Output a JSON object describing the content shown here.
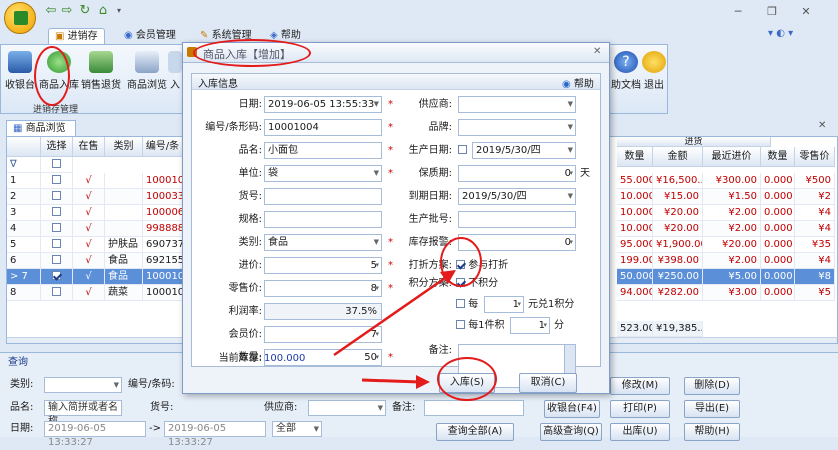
{
  "ribbon": {
    "tabs": [
      "进销存",
      "会员管理",
      "系统管理",
      "帮助"
    ],
    "buttons": [
      "收银台",
      "商品入库",
      "销售退货",
      "商品浏览",
      "入"
    ],
    "right_buttons": [
      "助文档",
      "退出"
    ],
    "group_label": "进销存管理"
  },
  "main_tab": "商品浏览",
  "grid": {
    "headers": [
      "选择",
      "在售",
      "类别",
      "编号/条"
    ],
    "right_group": "进货",
    "right_headers": [
      "数量",
      "金额",
      "最近进价",
      "数量",
      "零售价"
    ],
    "filter_row": "∇",
    "rows": [
      {
        "num": "1",
        "sel": false,
        "onsale": "√",
        "cat": "",
        "code": "100010",
        "qty": "55.000",
        "amount": "¥16,500....",
        "last": "¥300.00",
        "q2": "0.000",
        "price": "¥500"
      },
      {
        "num": "2",
        "sel": false,
        "onsale": "√",
        "cat": "",
        "code": "100033",
        "qty": "10.000",
        "amount": "¥15.00",
        "last": "¥1.50",
        "q2": "0.000",
        "price": "¥2"
      },
      {
        "num": "3",
        "sel": false,
        "onsale": "√",
        "cat": "",
        "code": "100006",
        "qty": "10.000",
        "amount": "¥20.00",
        "last": "¥2.00",
        "q2": "0.000",
        "price": "¥4"
      },
      {
        "num": "4",
        "sel": false,
        "onsale": "√",
        "cat": "",
        "code": "998888",
        "qty": "10.000",
        "amount": "¥20.00",
        "last": "¥2.00",
        "q2": "0.000",
        "price": "¥4"
      },
      {
        "num": "5",
        "sel": false,
        "onsale": "√",
        "cat": "护肤品",
        "code": "690737",
        "qty": "95.000",
        "amount": "¥1,900.00",
        "last": "¥20.00",
        "q2": "0.000",
        "price": "¥35"
      },
      {
        "num": "6",
        "sel": false,
        "onsale": "√",
        "cat": "食品",
        "code": "692155",
        "qty": "199.000",
        "amount": "¥398.00",
        "last": "¥2.00",
        "q2": "0.000",
        "price": "¥4"
      },
      {
        "num": "> 7",
        "sel": true,
        "onsale": "√",
        "cat": "食品",
        "code": "100010",
        "qty": "50.000",
        "amount": "¥250.00",
        "last": "¥5.00",
        "q2": "0.000",
        "price": "¥8"
      },
      {
        "num": "8",
        "sel": false,
        "onsale": "√",
        "cat": "蔬菜",
        "code": "100010",
        "qty": "94.000",
        "amount": "¥282.00",
        "last": "¥3.00",
        "q2": "0.000",
        "price": "¥5"
      }
    ],
    "totals": {
      "qty": "523.000",
      "amount": "¥19,385..."
    }
  },
  "query": {
    "title": "查询",
    "labels": {
      "category": "类别:",
      "code": "编号/条码:",
      "name": "品名:",
      "goods_no": "货号:",
      "supplier": "供应商:",
      "note": "备注:",
      "date": "日期:"
    },
    "name_value": "输入简拼或者名称",
    "date_from": "2019-06-05 13:33:27",
    "date_to": "2019-06-05 13:33:27",
    "date_sep": "->",
    "range": "全部",
    "buttons": [
      "修改(M)",
      "删除(D)",
      "收银台(F4)",
      "打印(P)",
      "导出(E)",
      "查询全部(A)",
      "高级查询(Q)",
      "出库(U)",
      "帮助(H)"
    ]
  },
  "dialog": {
    "title": "商品入库【增加】",
    "section": "入库信息",
    "help": "帮助",
    "fields": {
      "date_label": "日期:",
      "date": "2019-06-05 13:55:33",
      "code_label": "编号/条形码:",
      "code": "10001004",
      "name_label": "品名:",
      "name": "小面包",
      "unit_label": "单位:",
      "unit": "袋",
      "goods_no_label": "货号:",
      "spec_label": "规格:",
      "category_label": "类别:",
      "category": "食品",
      "cost_label": "进价:",
      "cost": "5",
      "retail_label": "零售价:",
      "retail": "8",
      "profit_label": "利润率:",
      "profit": "37.5%",
      "member_label": "会员价:",
      "member": "7",
      "qty_label": "数量:",
      "qty": "50",
      "stock_label": "当前库存:",
      "stock": "100.000",
      "supplier_label": "供应商:",
      "brand_label": "品牌:",
      "prod_date_label": "生产日期:",
      "prod_date": "2019/5/30/四",
      "shelf_label": "保质期:",
      "shelf": "0",
      "shelf_unit": "天",
      "expire_label": "到期日期:",
      "expire": "2019/5/30/四",
      "batch_label": "生产批号:",
      "stock_alarm_label": "库存报警:",
      "stock_alarm": "0",
      "discount_label": "打折方案:",
      "discount_opt": "参与打折",
      "points_label": "积分方案:",
      "points_opt": "不积分",
      "every_label": "每",
      "every_value": "1",
      "every_text": "元兑1积分",
      "per_item_label": "每1件积",
      "per_item_value": "1",
      "per_item_unit": "分",
      "note_label": "备注:"
    },
    "ok": "入库(S)",
    "cancel": "取消(C)"
  }
}
